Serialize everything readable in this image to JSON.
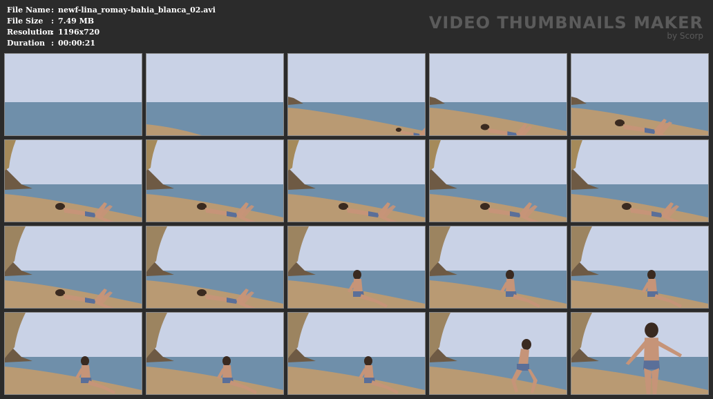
{
  "info": {
    "rows": [
      {
        "key": "File Name",
        "value": "newf-lina_romay-bahia_blanca_02.avi"
      },
      {
        "key": "File Size",
        "value": "7.49 MB"
      },
      {
        "key": "Resolution",
        "value": "1196x720"
      },
      {
        "key": "Duration",
        "value": "00:00:21"
      }
    ]
  },
  "brand": {
    "title": "VIDEO THUMBNAILS MAKER",
    "subtitle": "by Scorp"
  },
  "colors": {
    "background": "#2b2b2b",
    "sky": "#c9d2e6",
    "sea": "#6f8faa",
    "sand": "#b99a73",
    "rock": "#6e5a44",
    "skin": "#c69478",
    "hair": "#3a2a20",
    "bikini": "#5a6f99"
  },
  "thumbnails": [
    {
      "scene": "sea-horizon"
    },
    {
      "scene": "sea-shore"
    },
    {
      "scene": "shore-figure-edge"
    },
    {
      "scene": "shore-figure-lying-far"
    },
    {
      "scene": "shore-figure-lying"
    },
    {
      "scene": "cliff-figure-lying"
    },
    {
      "scene": "cliff-figure-lying"
    },
    {
      "scene": "cliff-figure-lying"
    },
    {
      "scene": "cliff-figure-lying"
    },
    {
      "scene": "cliff-figure-lying"
    },
    {
      "scene": "cave-figure-lying"
    },
    {
      "scene": "cave-figure-lying"
    },
    {
      "scene": "cave-figure-sitting-up"
    },
    {
      "scene": "cave-figure-sitting"
    },
    {
      "scene": "cave-figure-sitting"
    },
    {
      "scene": "cave-figure-sitting"
    },
    {
      "scene": "cave-figure-sitting"
    },
    {
      "scene": "cave-figure-sitting"
    },
    {
      "scene": "cave-figure-crouching"
    },
    {
      "scene": "cave-figure-standing"
    }
  ]
}
